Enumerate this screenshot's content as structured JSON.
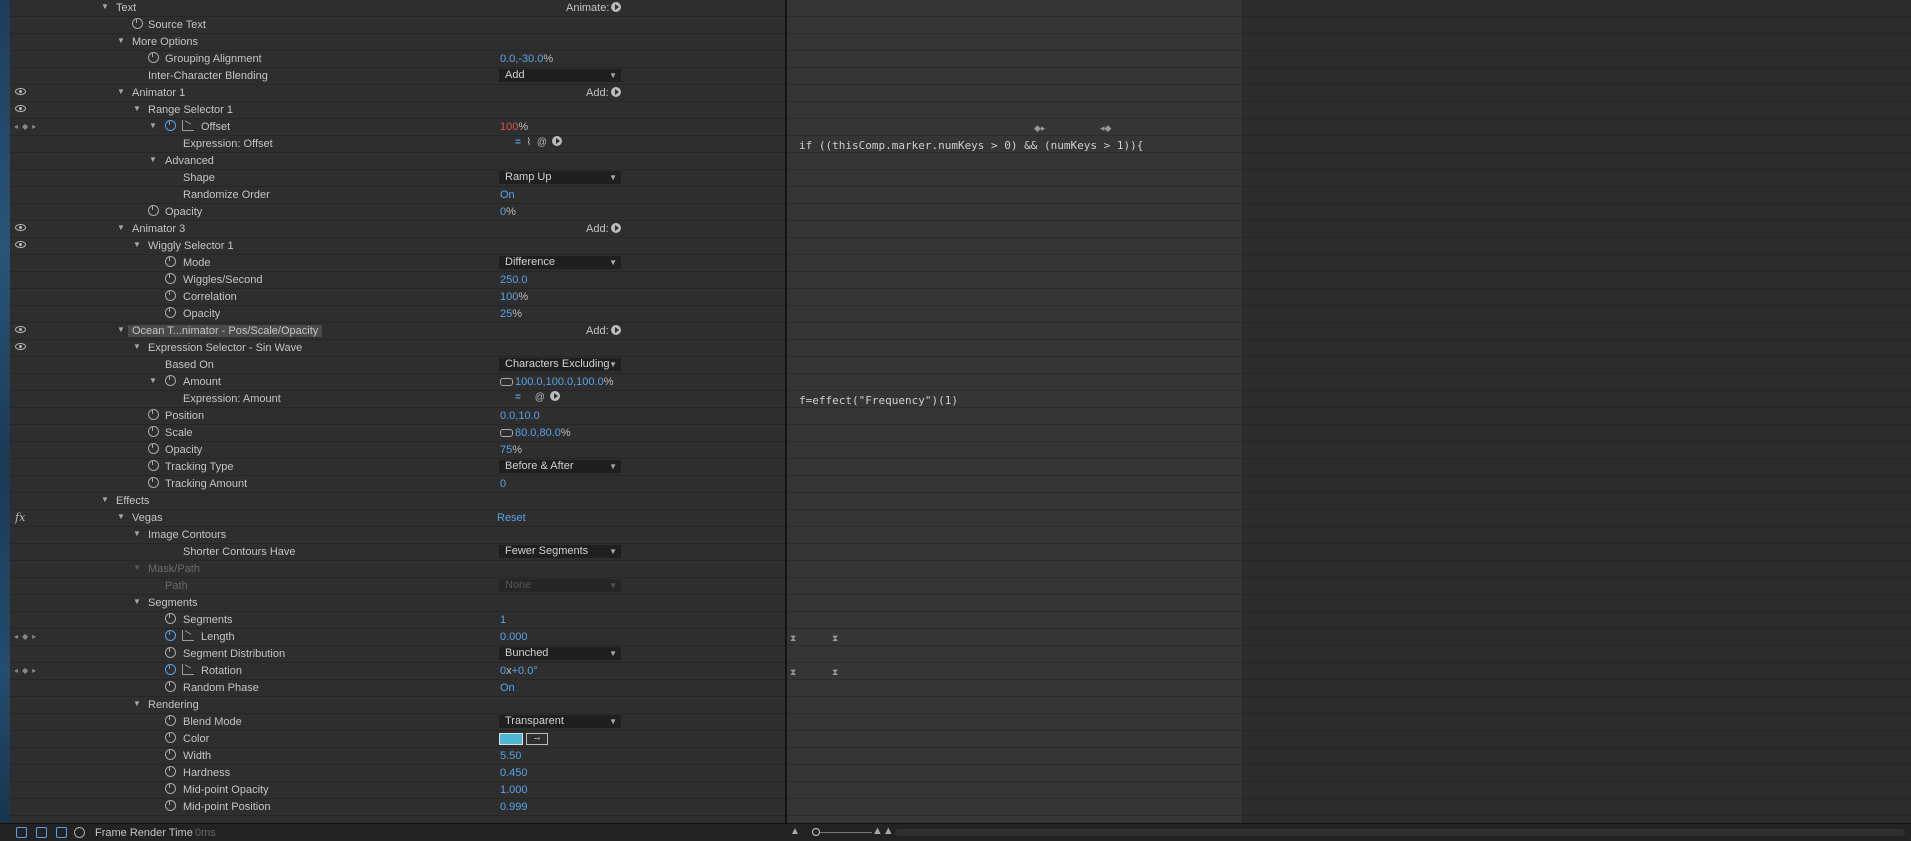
{
  "properties": {
    "text": "Text",
    "animate": "Animate:",
    "source_text": "Source Text",
    "more_options": "More Options",
    "grouping_alignment": {
      "label": "Grouping Alignment",
      "value": "0.0,-30.0",
      "unit": "%"
    },
    "inter_char_blending": {
      "label": "Inter-Character Blending",
      "value": "Add"
    },
    "animator1": "Animator 1",
    "add_label": "Add:",
    "range_selector": "Range Selector 1",
    "offset": {
      "label": "Offset",
      "value": "100",
      "unit": "%"
    },
    "expr_offset": "Expression: Offset",
    "advanced": "Advanced",
    "shape": {
      "label": "Shape",
      "value": "Ramp Up"
    },
    "randomize_order": {
      "label": "Randomize Order",
      "value": "On"
    },
    "opacity1": {
      "label": "Opacity",
      "value": "0",
      "unit": "%"
    },
    "animator3": "Animator 3",
    "wiggly_selector": "Wiggly Selector 1",
    "mode": {
      "label": "Mode",
      "value": "Difference"
    },
    "wiggles": {
      "label": "Wiggles/Second",
      "value": "250.0"
    },
    "correlation": {
      "label": "Correlation",
      "value": "100",
      "unit": "%"
    },
    "opacity2": {
      "label": "Opacity",
      "value": "25",
      "unit": "%"
    },
    "ocean_animator": "Ocean T...nimator - Pos/Scale/Opacity",
    "expr_selector": "Expression Selector - Sin Wave",
    "based_on": {
      "label": "Based On",
      "value": "Characters Excluding"
    },
    "amount": {
      "label": "Amount",
      "value": "100.0,100.0,100.0",
      "unit": "%"
    },
    "expr_amount": "Expression: Amount",
    "position": {
      "label": "Position",
      "value": "0.0,10.0"
    },
    "scale": {
      "label": "Scale",
      "value": "80.0,80.0",
      "unit": "%"
    },
    "opacity3": {
      "label": "Opacity",
      "value": "75",
      "unit": "%"
    },
    "tracking_type": {
      "label": "Tracking Type",
      "value": "Before & After"
    },
    "tracking_amount": {
      "label": "Tracking Amount",
      "value": "0"
    },
    "effects": "Effects",
    "vegas": {
      "label": "Vegas",
      "reset": "Reset"
    },
    "image_contours": "Image Contours",
    "shorter_contours": {
      "label": "Shorter Contours Have",
      "value": "Fewer Segments"
    },
    "mask_path": "Mask/Path",
    "path": {
      "label": "Path",
      "value": "None"
    },
    "segments_group": "Segments",
    "segments": {
      "label": "Segments",
      "value": "1"
    },
    "length": {
      "label": "Length",
      "value": "0.000"
    },
    "segment_distribution": {
      "label": "Segment Distribution",
      "value": "Bunched"
    },
    "rotation": {
      "label": "Rotation",
      "value_a": "0",
      "value_x": "x",
      "value_b": "+0.0°"
    },
    "random_phase": {
      "label": "Random Phase",
      "value": "On"
    },
    "rendering": "Rendering",
    "blend_mode": {
      "label": "Blend Mode",
      "value": "Transparent"
    },
    "color": {
      "label": "Color",
      "swatch": "#4fb7d6"
    },
    "width": {
      "label": "Width",
      "value": "5.50"
    },
    "hardness": {
      "label": "Hardness",
      "value": "0.450"
    },
    "midpoint_opacity": {
      "label": "Mid-point Opacity",
      "value": "1.000"
    },
    "midpoint_position": {
      "label": "Mid-point Position",
      "value": "0.999"
    }
  },
  "timeline": {
    "expr1": "if ((thisComp.marker.numKeys > 0) && (numKeys > 1)){",
    "expr2": "f=effect(\"Frequency\")(1)"
  },
  "status": {
    "frame_render_time": "Frame Render Time",
    "frame_render_value": "0ms"
  },
  "colors": {
    "value_blue": "#5aa0e6",
    "offset_red": "#e05050",
    "panel_bg": "#2e2e2e"
  }
}
